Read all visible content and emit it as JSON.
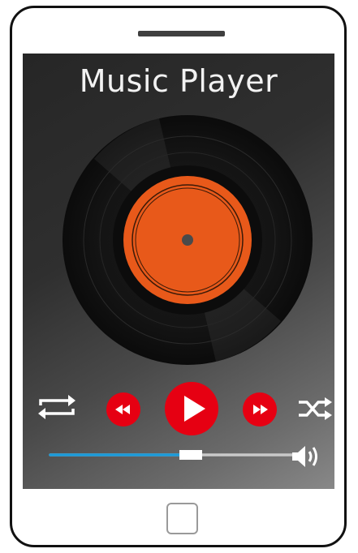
{
  "app": {
    "title": "Music Player"
  },
  "player": {
    "repeat_icon": "repeat-icon",
    "rewind_icon": "rewind-icon",
    "play_icon": "play-icon",
    "forward_icon": "fast-forward-icon",
    "shuffle_icon": "shuffle-icon",
    "volume_icon": "volume-icon",
    "progress_fraction": 0.53
  },
  "colors": {
    "accent_red": "#e60012",
    "label_orange": "#e8591a",
    "progress_blue": "#1a9ad9"
  }
}
